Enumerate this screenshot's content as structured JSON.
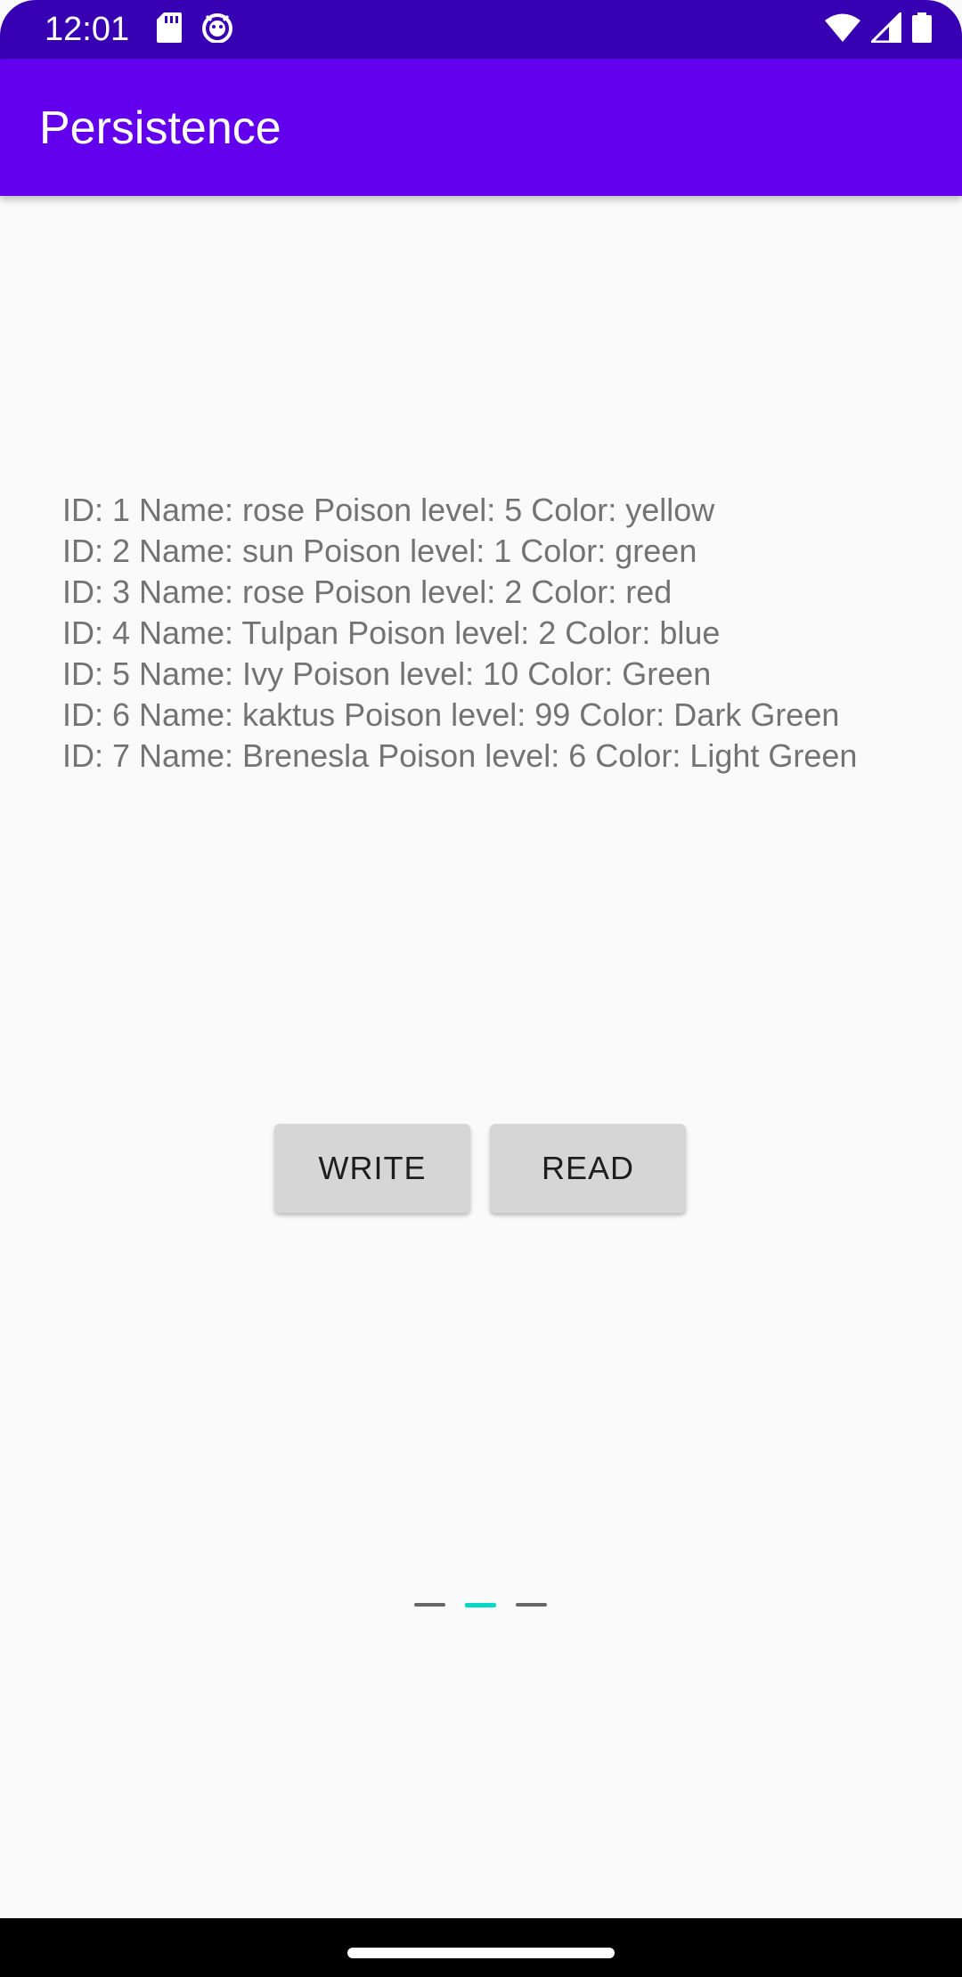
{
  "status_bar": {
    "time": "12:01",
    "left_icons": [
      "sd-card-icon",
      "android-debug-icon"
    ],
    "right_icons": [
      "wifi-icon",
      "cell-signal-icon",
      "battery-icon"
    ]
  },
  "app_bar": {
    "title": "Persistence",
    "color": "#6200ee"
  },
  "records": [
    "ID: 1 Name: rose Poison level: 5 Color: yellow",
    "ID: 2 Name: sun Poison level: 1 Color: green",
    "ID: 3 Name: rose Poison level: 2 Color: red",
    "ID: 4 Name: Tulpan Poison level: 2 Color: blue",
    "ID: 5 Name: Ivy Poison level: 10 Color: Green",
    "ID: 6 Name: kaktus Poison level: 99 Color: Dark Green",
    "ID: 7 Name: Brenesla Poison level: 6 Color: Light Green"
  ],
  "buttons": {
    "write_label": "WRITE",
    "read_label": "READ"
  },
  "progress": {
    "accent": "#03dac5",
    "active_index": 1,
    "count": 3
  }
}
